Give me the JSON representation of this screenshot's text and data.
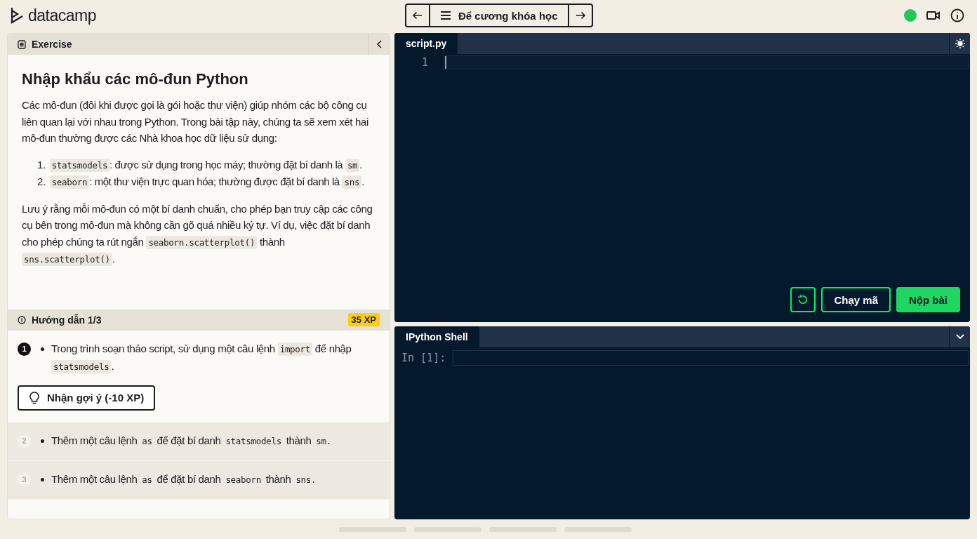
{
  "header": {
    "logo": "datacamp",
    "course_outline": "Để cương khóa học",
    "online": true
  },
  "exercise": {
    "tab": "Exercise",
    "title": "Nhập khẩu các mô-đun Python",
    "intro": [
      {
        "kind": "text",
        "text": "Các mô-đun (đôi khi được gọi là gói hoặc thư viện) giúp nhóm các bộ công cụ liên quan lại với nhau trong Python. Trong bài tập này, chúng ta sẽ xem xét hai mô-đun thường được các Nhà khoa học dữ liệu sử dụng:"
      }
    ],
    "list": [
      {
        "number": "1.",
        "parts": [
          {
            "kind": "code",
            "text": "statsmodels"
          },
          {
            "kind": "text",
            "text": ": được sử dụng trong học máy; thường đặt bí danh là "
          },
          {
            "kind": "code",
            "text": "sm"
          },
          {
            "kind": "text",
            "text": "."
          }
        ]
      },
      {
        "number": "2.",
        "parts": [
          {
            "kind": "code",
            "text": "seaborn"
          },
          {
            "kind": "text",
            "text": ": một thư viện trực quan hóa; thường được đặt bí danh là "
          },
          {
            "kind": "code",
            "text": "sns"
          },
          {
            "kind": "text",
            "text": "."
          }
        ]
      }
    ],
    "note": [
      {
        "kind": "text",
        "text": "Lưu ý rằng mỗi mô-đun có một bí danh chuẩn, cho phép bạn truy cập các công cụ bên trong mô-đun mà không cần gõ quá nhiều ký tự. Ví dụ, việc đặt bí danh cho phép chúng ta rút ngắn "
      },
      {
        "kind": "code",
        "text": "seaborn.scatterplot()"
      },
      {
        "kind": "text",
        "text": " thành "
      },
      {
        "kind": "code",
        "text": "sns.scatterplot()"
      },
      {
        "kind": "text",
        "text": "."
      }
    ]
  },
  "instructions": {
    "title": "Hướng dẫn 1/3",
    "xp": "35 XP",
    "hint": "Nhận gợi ý (-10 XP)",
    "steps": [
      {
        "number": "1",
        "selected": true,
        "parts": [
          {
            "kind": "text",
            "text": "Trong trình soạn thảo script, sử dụng một câu lệnh "
          },
          {
            "kind": "code",
            "text": "import"
          },
          {
            "kind": "text",
            "text": " để nhập "
          },
          {
            "kind": "code",
            "text": "statsmodels"
          },
          {
            "kind": "text",
            "text": "."
          }
        ]
      },
      {
        "number": "2",
        "selected": false,
        "parts": [
          {
            "kind": "text",
            "text": "Thêm một câu lệnh "
          },
          {
            "kind": "plain-code",
            "text": "as"
          },
          {
            "kind": "text",
            "text": " để đặt bí danh "
          },
          {
            "kind": "plain-code",
            "text": "statsmodels"
          },
          {
            "kind": "text",
            "text": " thành "
          },
          {
            "kind": "plain-code",
            "text": "sm."
          }
        ]
      },
      {
        "number": "3",
        "selected": false,
        "parts": [
          {
            "kind": "text",
            "text": "Thêm một câu lệnh "
          },
          {
            "kind": "plain-code",
            "text": "as"
          },
          {
            "kind": "text",
            "text": " để đặt bí danh "
          },
          {
            "kind": "plain-code",
            "text": "seaborn"
          },
          {
            "kind": "text",
            "text": " thành "
          },
          {
            "kind": "plain-code",
            "text": "sns."
          }
        ]
      }
    ]
  },
  "editor": {
    "tab": "script.py",
    "line_numbers": [
      "1"
    ],
    "run": "Chạy mã",
    "submit": "Nộp bài"
  },
  "shell": {
    "tab": "IPython Shell",
    "prompt": "In [1]:"
  }
}
